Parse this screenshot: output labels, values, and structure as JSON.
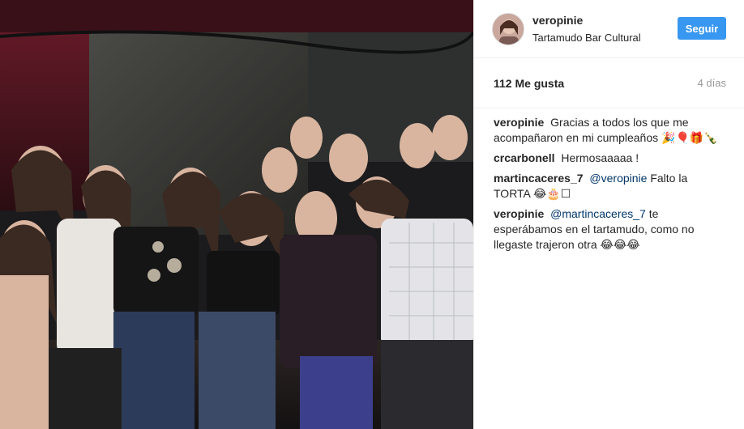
{
  "post": {
    "author": "veropinie",
    "location": "Tartamudo Bar Cultural",
    "follow_label": "Seguir",
    "likes": "112 Me gusta",
    "age": "4 días"
  },
  "comments": [
    {
      "user": "veropinie",
      "text": "Gracias a todos los que me acompañaron en mi cumpleaños 🎉🎈🎁🍾"
    },
    {
      "user": "crcarbonell",
      "text": "Hermosaaaaa !"
    },
    {
      "user": "martincaceres_7",
      "mention": "@veropinie",
      "text": "Falto la TORTA 😂🎂☐"
    },
    {
      "user": "veropinie",
      "mention": "@martincaceres_7",
      "text": "te esperábamos en el tartamudo, como no llegaste trajeron otra 😂😂😂"
    }
  ],
  "colors": {
    "accent": "#3897f0",
    "mention": "#003569",
    "muted": "#999999"
  }
}
